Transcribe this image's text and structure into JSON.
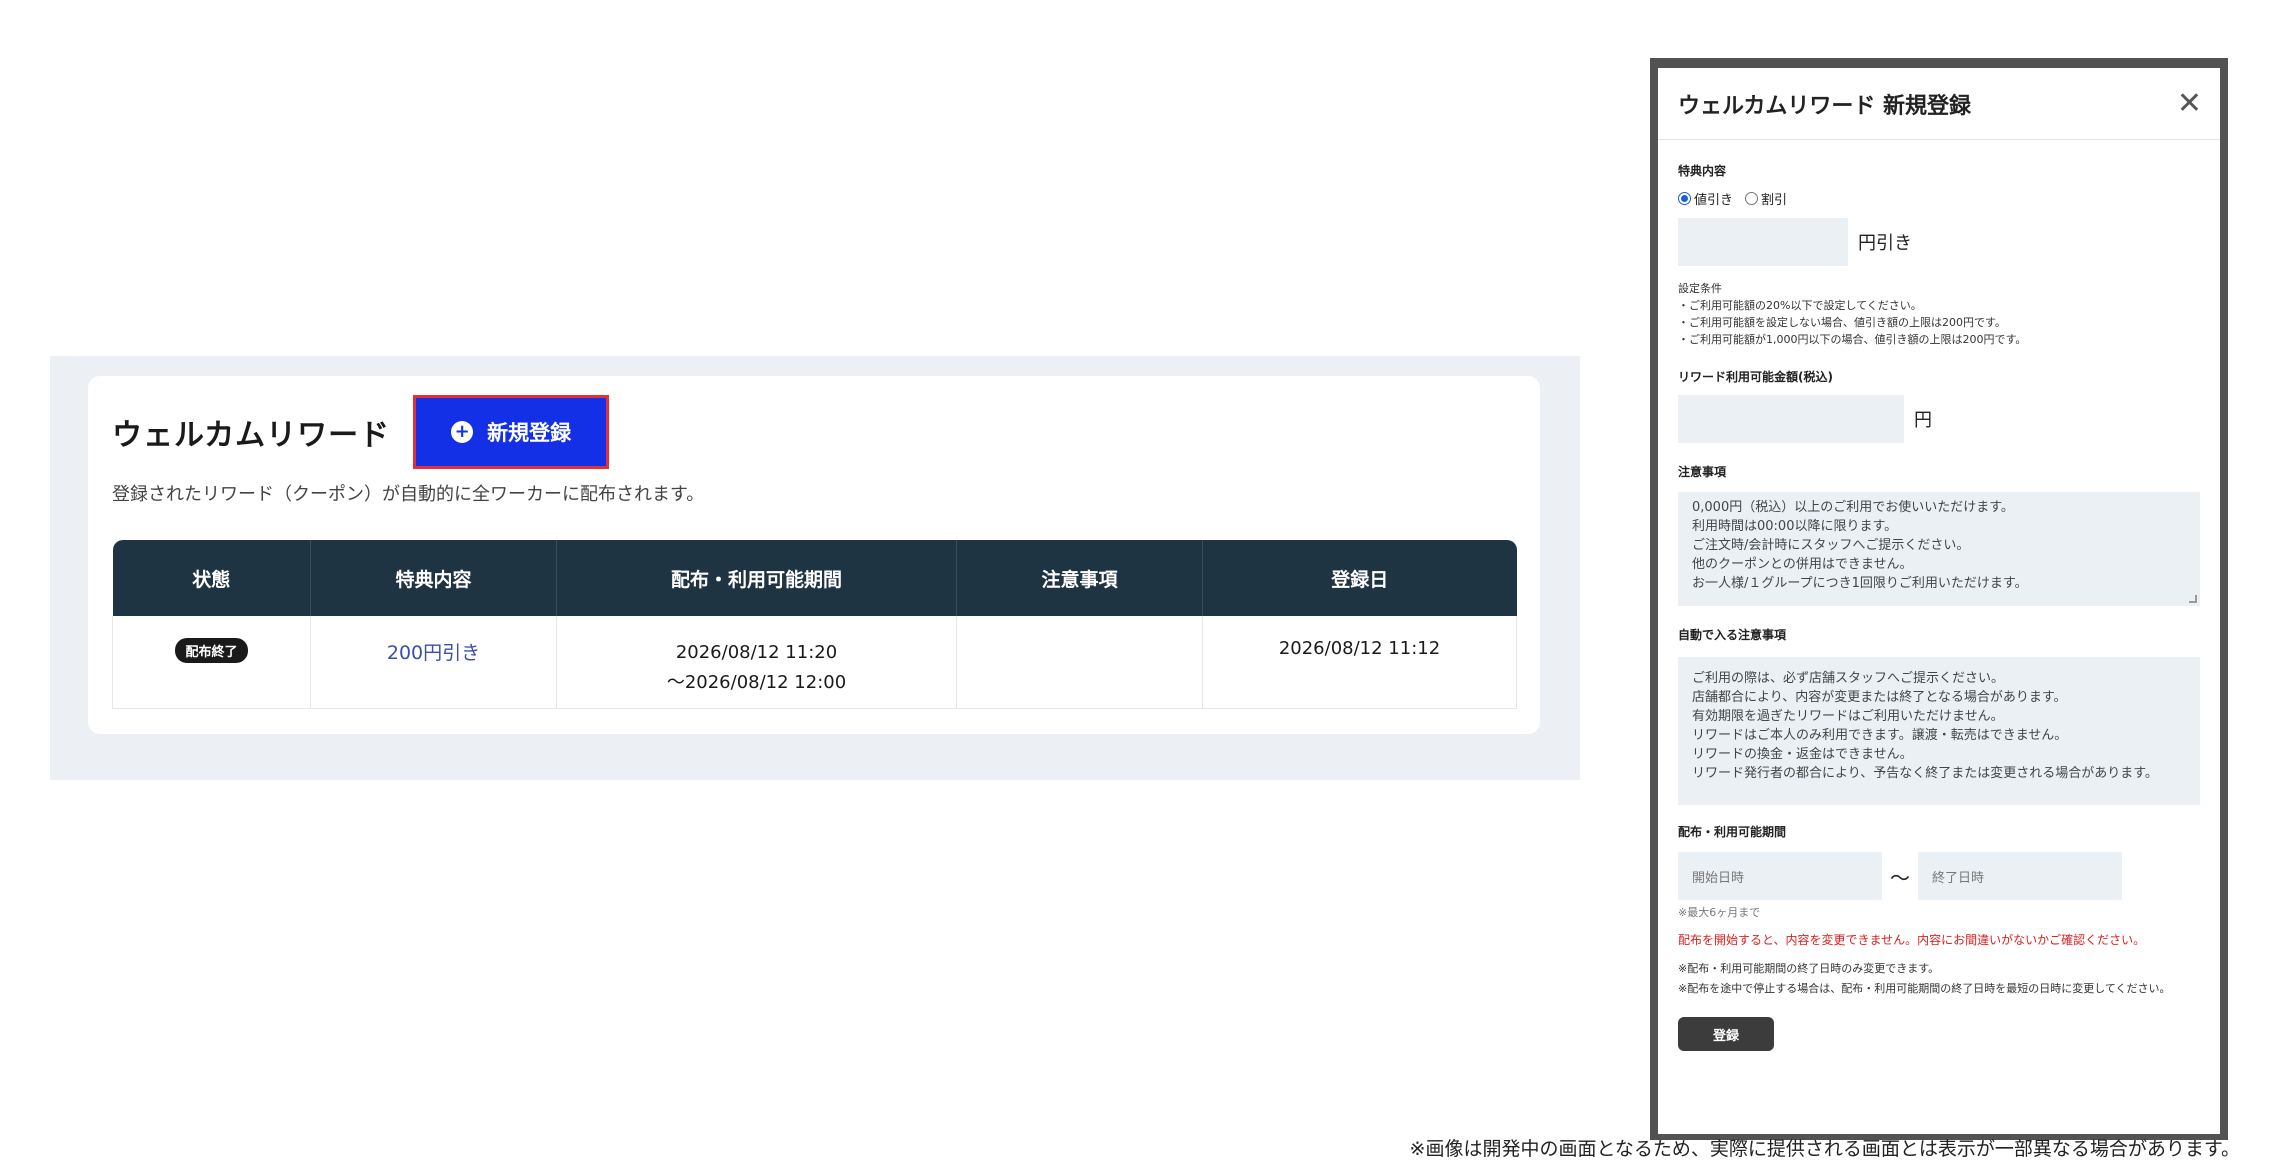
{
  "main": {
    "title": "ウェルカムリワード",
    "new_button_label": "新規登録",
    "description": "登録されたリワード（クーポン）が自動的に全ワーカーに配布されます。",
    "table": {
      "headers": [
        "状態",
        "特典内容",
        "配布・利用可能期間",
        "注意事項",
        "登録日"
      ],
      "rows": [
        {
          "status": "配布終了",
          "benefit": "200円引き",
          "period_start": "2026/08/12 11:20",
          "period_end": "〜2026/08/12 12:00",
          "notes": "",
          "registered": "2026/08/12 11:12"
        }
      ]
    }
  },
  "modal": {
    "title": "ウェルカムリワード 新規登録",
    "benefit_label": "特典内容",
    "radio_discount": "値引き",
    "radio_percent": "割引",
    "discount_unit": "円引き",
    "conditions": [
      "設定条件",
      "・ご利用可能額の20%以下で設定してください。",
      "・ご利用可能額を設定しない場合、値引き額の上限は200円です。",
      "・ご利用可能額が1,000円以下の場合、値引き額の上限は200円です。"
    ],
    "min_amount_label": "リワード利用可能金額(税込)",
    "min_amount_unit": "円",
    "notes_label": "注意事項",
    "notes_placeholder": [
      "0,000円（税込）以上のご利用でお使いいただけます。",
      "利用時間は00:00以降に限ります。",
      "ご注文時/会計時にスタッフへご提示ください。",
      "他のクーポンとの併用はできません。",
      "お一人様/１グループにつき1回限りご利用いただけます。"
    ],
    "auto_notes_label": "自動で入る注意事項",
    "auto_notes": [
      "ご利用の際は、必ず店舗スタッフへご提示ください。",
      "店舗都合により、内容が変更または終了となる場合があります。",
      "有効期限を過ぎたリワードはご利用いただけません。",
      "リワードはご本人のみ利用できます。譲渡・転売はできません。",
      "リワードの換金・返金はできません。",
      "リワード発行者の都合により、予告なく終了または変更される場合があります。"
    ],
    "period_label": "配布・利用可能期間",
    "start_placeholder": "開始日時",
    "end_placeholder": "終了日時",
    "tilde": "〜",
    "max_note": "※最大6ヶ月まで",
    "warning": "配布を開始すると、内容を変更できません。内容にお間違いがないかご確認ください。",
    "info_lines": [
      "※配布・利用可能期間の終了日時のみ変更できます。",
      "※配布を途中で停止する場合は、配布・利用可能期間の終了日時を最短の日時に変更してください。"
    ],
    "register_label": "登録"
  },
  "footnote": "※画像は開発中の画面となるため、実際に提供される画面とは表示が一部異なる場合があります。",
  "colors": {
    "primary_button": "#1430e6",
    "highlight_border": "#e0323c",
    "table_header": "#1f3443",
    "panel_bg": "#ecf0f4",
    "field_bg": "#eaf0f4",
    "warning": "#e01e1e"
  },
  "icons": {
    "new_button": "plus-circle-icon",
    "modal_close": "close-icon"
  }
}
